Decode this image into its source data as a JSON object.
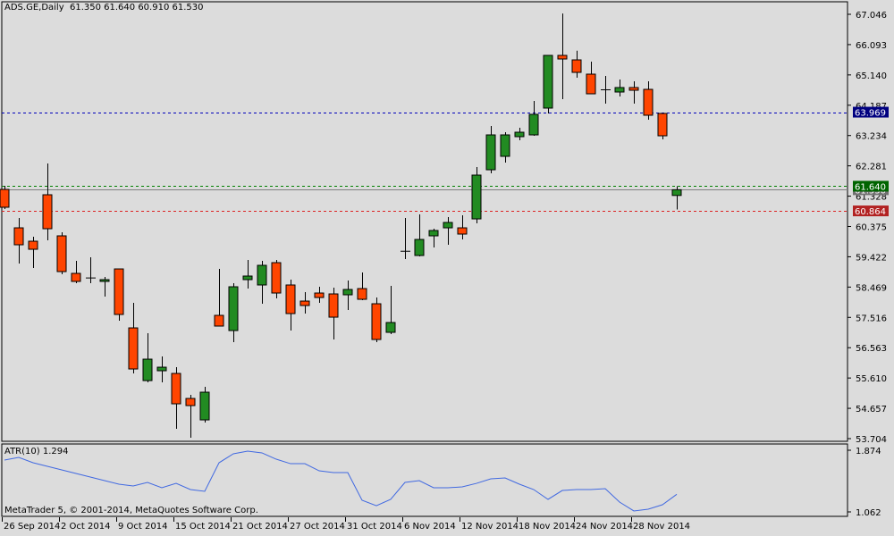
{
  "header": {
    "symbol": "ADS.GE,Daily",
    "ohlc": "61.350 61.640 60.910 61.530"
  },
  "colors": {
    "bull": "#228b22",
    "bear": "#ff4500",
    "background": "#dcdcdc",
    "ask_line": "#008000",
    "bid_line": "#808080",
    "low_line": "#cc0000",
    "level_line": "#0000aa",
    "atr_line": "#4169e1"
  },
  "price_axis": {
    "ticks": [
      "67.046",
      "66.093",
      "65.140",
      "64.187",
      "63.234",
      "62.281",
      "61.328",
      "60.375",
      "59.422",
      "58.469",
      "57.516",
      "56.563",
      "55.610",
      "54.657",
      "53.704"
    ],
    "min": 53.704,
    "max": 67.046
  },
  "lines": [
    {
      "name": "level-line",
      "value": 63.969,
      "label": "63.969",
      "color": "#000080",
      "dashed": true
    },
    {
      "name": "ask-line",
      "value": 61.64,
      "label": "61.640",
      "color": "#006400",
      "dashed": true
    },
    {
      "name": "bid-line",
      "value": 61.53,
      "label": "61.530",
      "color": "#707070",
      "dashed": false
    },
    {
      "name": "low-line",
      "value": 60.864,
      "label": "60.864",
      "color": "#b22222",
      "dashed": true
    }
  ],
  "chart_data": {
    "type": "candlestick",
    "title": "ADS.GE,Daily",
    "candles": [
      [
        61.54,
        61.653,
        60.922,
        60.979
      ],
      [
        60.332,
        60.641,
        59.209,
        59.799
      ],
      [
        59.911,
        60.052,
        59.068,
        59.658
      ],
      [
        61.372,
        62.355,
        59.939,
        60.304
      ],
      [
        60.08,
        60.192,
        58.872,
        58.956
      ],
      [
        58.9,
        59.293,
        58.591,
        58.647
      ],
      [
        58.759,
        59.406,
        58.591,
        58.77
      ],
      [
        58.647,
        58.788,
        58.17,
        58.703
      ],
      [
        59.04,
        59.04,
        57.411,
        57.608
      ],
      [
        57.186,
        57.973,
        55.754,
        55.894
      ],
      [
        55.529,
        57.018,
        55.473,
        56.203
      ],
      [
        55.838,
        56.288,
        55.473,
        55.95
      ],
      [
        55.754,
        55.95,
        54.012,
        54.799
      ],
      [
        54.967,
        55.08,
        53.731,
        54.743
      ],
      [
        54.293,
        55.332,
        54.209,
        55.164
      ],
      [
        57.58,
        59.04,
        57.243,
        57.243
      ],
      [
        57.102,
        58.591,
        56.737,
        58.479
      ],
      [
        58.703,
        59.321,
        58.422,
        58.816
      ],
      [
        58.535,
        59.293,
        57.945,
        59.153
      ],
      [
        59.237,
        59.321,
        58.113,
        58.282
      ],
      [
        58.535,
        58.703,
        57.102,
        57.636
      ],
      [
        58.029,
        58.31,
        57.636,
        57.889
      ],
      [
        58.282,
        58.479,
        57.973,
        58.141
      ],
      [
        58.254,
        58.45,
        56.821,
        57.523
      ],
      [
        58.226,
        58.675,
        57.748,
        58.394
      ],
      [
        58.422,
        58.928,
        58.057,
        58.085
      ],
      [
        57.945,
        58.141,
        56.737,
        56.821
      ],
      [
        57.046,
        58.507,
        56.99,
        57.355
      ],
      [
        59.602,
        60.641,
        59.349,
        59.61
      ],
      [
        59.462,
        60.754,
        59.434,
        59.967
      ],
      [
        60.08,
        60.304,
        59.715,
        60.248
      ],
      [
        60.332,
        60.67,
        59.799,
        60.501
      ],
      [
        60.332,
        60.726,
        59.967,
        60.136
      ],
      [
        60.613,
        62.243,
        60.473,
        61.99
      ],
      [
        62.158,
        63.535,
        62.046,
        63.254
      ],
      [
        62.58,
        63.338,
        62.383,
        63.254
      ],
      [
        63.198,
        63.479,
        63.085,
        63.338
      ],
      [
        63.254,
        64.321,
        63.226,
        63.9
      ],
      [
        64.097,
        65.754,
        63.928,
        65.754
      ],
      [
        65.754,
        67.07,
        64.377,
        65.641
      ],
      [
        65.613,
        65.9,
        65.052,
        65.22
      ],
      [
        65.164,
        65.557,
        64.546,
        64.546
      ],
      [
        64.686,
        65.108,
        64.237,
        64.68
      ],
      [
        64.602,
        64.995,
        64.462,
        64.743
      ],
      [
        64.743,
        64.939,
        64.237,
        64.658
      ],
      [
        64.686,
        64.939,
        63.731,
        63.872
      ],
      [
        63.928,
        63.928,
        63.113,
        63.226
      ],
      [
        61.35,
        61.64,
        60.91,
        61.53
      ]
    ],
    "x_labels": [
      "26 Sep 2014",
      "2 Oct 2014",
      "9 Oct 2014",
      "15 Oct 2014",
      "21 Oct 2014",
      "27 Oct 2014",
      "31 Oct 2014",
      "6 Nov 2014",
      "12 Nov 2014",
      "18 Nov 2014",
      "24 Nov 2014",
      "28 Nov 2014"
    ],
    "indicator": {
      "name": "ATR(10)",
      "label": "ATR(10) 1.294",
      "ylim": [
        1.062,
        1.874
      ],
      "ticks": [
        "1.874",
        "1.062"
      ],
      "values": [
        1.745,
        1.78,
        1.709,
        1.662,
        1.615,
        1.568,
        1.521,
        1.474,
        1.427,
        1.403,
        1.45,
        1.38,
        1.438,
        1.356,
        1.333,
        1.709,
        1.827,
        1.862,
        1.839,
        1.756,
        1.697,
        1.697,
        1.603,
        1.58,
        1.58,
        1.215,
        1.144,
        1.227,
        1.45,
        1.474,
        1.38,
        1.38,
        1.391,
        1.438,
        1.497,
        1.509,
        1.427,
        1.356,
        1.227,
        1.344,
        1.356,
        1.356,
        1.368,
        1.191,
        1.074,
        1.097,
        1.156,
        1.294
      ]
    }
  },
  "footer": {
    "copyright": "MetaTrader 5, © 2001-2014, MetaQuotes Software Corp."
  }
}
